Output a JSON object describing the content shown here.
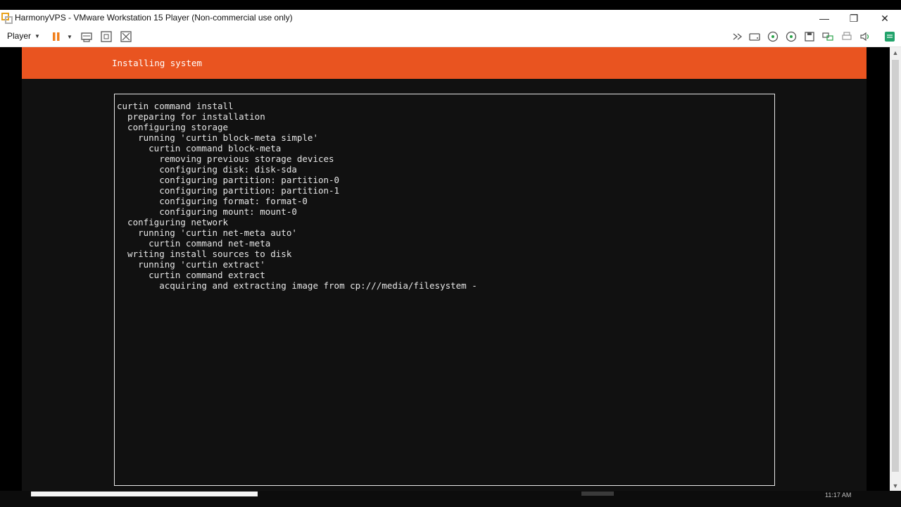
{
  "window": {
    "title": "HarmonyVPS - VMware Workstation 15 Player (Non-commercial use only)",
    "controls": {
      "minimize": "—",
      "maximize": "❐",
      "close": "✕"
    }
  },
  "toolbar": {
    "player_label": "Player",
    "icons": [
      "pause-icon",
      "send-keys-icon",
      "fullscreen-icon",
      "unity-icon",
      "devices-icon",
      "hdd-icon",
      "cd-icon",
      "usb-icon",
      "floppy-icon",
      "network-icon",
      "printer-icon",
      "sound-icon",
      "message-icon"
    ]
  },
  "installer": {
    "header": "Installing system",
    "accent_color": "#e95420",
    "log_lines": [
      "curtin command install",
      "  preparing for installation",
      "  configuring storage",
      "    running 'curtin block-meta simple'",
      "      curtin command block-meta",
      "        removing previous storage devices",
      "        configuring disk: disk-sda",
      "        configuring partition: partition-0",
      "        configuring partition: partition-1",
      "        configuring format: format-0",
      "        configuring mount: mount-0",
      "  configuring network",
      "    running 'curtin net-meta auto'",
      "      curtin command net-meta",
      "  writing install sources to disk",
      "    running 'curtin extract'",
      "      curtin command extract",
      "        acquiring and extracting image from cp:///media/filesystem -"
    ]
  },
  "taskbar": {
    "clock_fragment": "11:17 AM"
  }
}
